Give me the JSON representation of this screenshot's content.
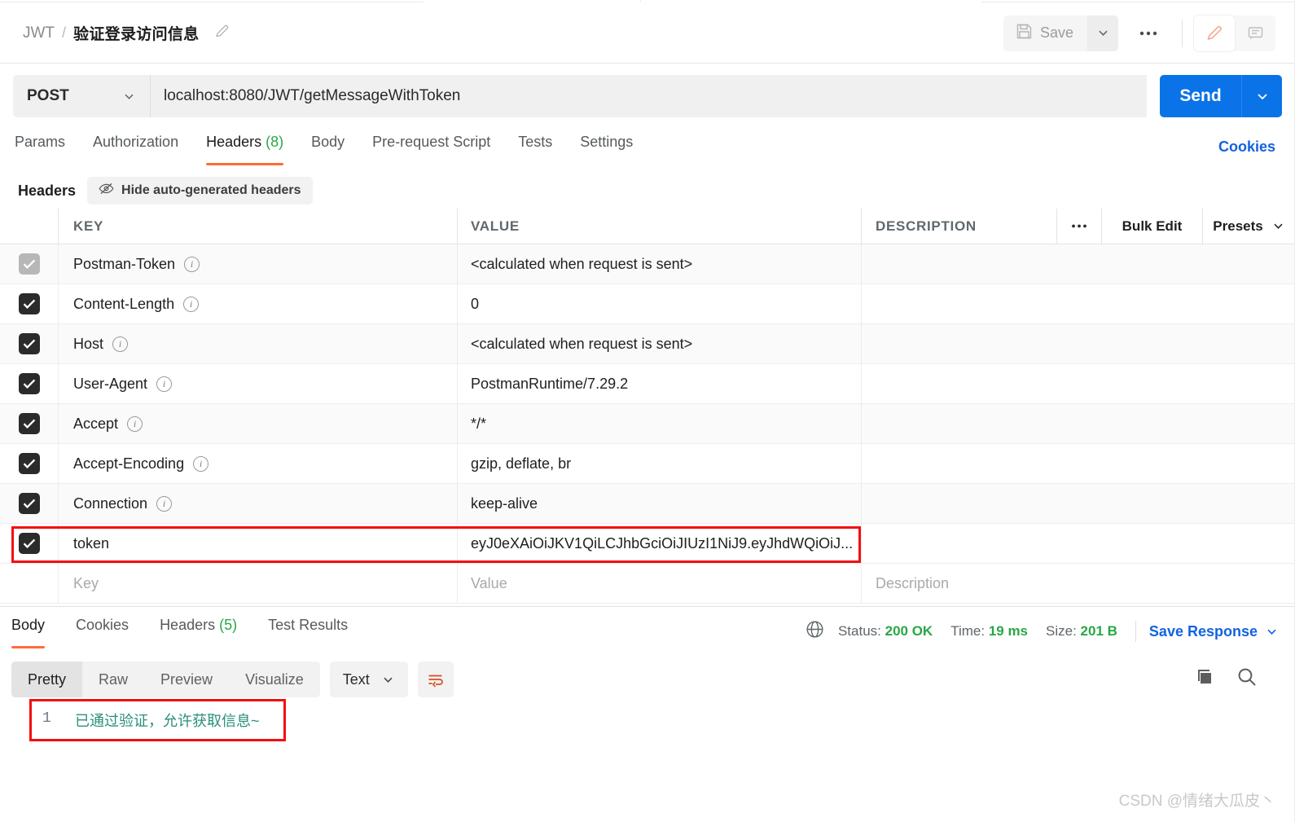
{
  "header": {
    "breadcrumb_root": "JWT",
    "breadcrumb_sep": "/",
    "breadcrumb_name": "验证登录访问信息",
    "save_label": "Save"
  },
  "url_bar": {
    "method": "POST",
    "url": "localhost:8080/JWT/getMessageWithToken",
    "send_label": "Send"
  },
  "request_tabs": [
    {
      "label": "Params",
      "count": "",
      "active": false
    },
    {
      "label": "Authorization",
      "count": "",
      "active": false
    },
    {
      "label": "Headers",
      "count": "(8)",
      "active": true
    },
    {
      "label": "Body",
      "count": "",
      "active": false
    },
    {
      "label": "Pre-request Script",
      "count": "",
      "active": false
    },
    {
      "label": "Tests",
      "count": "",
      "active": false
    },
    {
      "label": "Settings",
      "count": "",
      "active": false
    }
  ],
  "cookies_link": "Cookies",
  "headers_subbar": {
    "title": "Headers",
    "hide_auto_label": "Hide auto-generated headers"
  },
  "headers_table": {
    "columns": {
      "key": "KEY",
      "value": "VALUE",
      "description": "DESCRIPTION",
      "bulk_edit": "Bulk Edit",
      "presets": "Presets"
    },
    "rows": [
      {
        "checked": true,
        "disabled": true,
        "key": "Postman-Token",
        "has_info": true,
        "value": "<calculated when request is sent>",
        "description": "",
        "highlighted": false
      },
      {
        "checked": true,
        "disabled": false,
        "key": "Content-Length",
        "has_info": true,
        "value": "0",
        "description": "",
        "highlighted": false
      },
      {
        "checked": true,
        "disabled": false,
        "key": "Host",
        "has_info": true,
        "value": "<calculated when request is sent>",
        "description": "",
        "highlighted": false
      },
      {
        "checked": true,
        "disabled": false,
        "key": "User-Agent",
        "has_info": true,
        "value": "PostmanRuntime/7.29.2",
        "description": "",
        "highlighted": false
      },
      {
        "checked": true,
        "disabled": false,
        "key": "Accept",
        "has_info": true,
        "value": "*/*",
        "description": "",
        "highlighted": false
      },
      {
        "checked": true,
        "disabled": false,
        "key": "Accept-Encoding",
        "has_info": true,
        "value": "gzip, deflate, br",
        "description": "",
        "highlighted": false
      },
      {
        "checked": true,
        "disabled": false,
        "key": "Connection",
        "has_info": true,
        "value": "keep-alive",
        "description": "",
        "highlighted": false
      },
      {
        "checked": true,
        "disabled": false,
        "key": "token",
        "has_info": false,
        "value": "eyJ0eXAiOiJKV1QiLCJhbGciOiJIUzI1NiJ9.eyJhdWQiOiJ...",
        "description": "",
        "highlighted": true
      }
    ],
    "empty_row": {
      "key_placeholder": "Key",
      "value_placeholder": "Value",
      "description_placeholder": "Description"
    }
  },
  "response": {
    "tabs": [
      {
        "label": "Body",
        "count": "",
        "active": true
      },
      {
        "label": "Cookies",
        "count": "",
        "active": false
      },
      {
        "label": "Headers",
        "count": "(5)",
        "active": false
      },
      {
        "label": "Test Results",
        "count": "",
        "active": false
      }
    ],
    "status_label": "Status:",
    "status_value": "200 OK",
    "time_label": "Time:",
    "time_value": "19 ms",
    "size_label": "Size:",
    "size_value": "201 B",
    "save_response": "Save Response",
    "view_modes": [
      {
        "label": "Pretty",
        "active": true
      },
      {
        "label": "Raw",
        "active": false
      },
      {
        "label": "Preview",
        "active": false
      },
      {
        "label": "Visualize",
        "active": false
      }
    ],
    "format": "Text",
    "line_number": "1",
    "body_text": "已通过验证，允许获取信息~"
  },
  "watermark": "CSDN @情绪大瓜皮丶",
  "colors": {
    "accent_orange": "#ff6c37",
    "link_blue": "#1263e0",
    "send_blue": "#0b73e8",
    "success_green": "#28a745",
    "body_teal": "#2a8f7a",
    "highlight_red": "#f50d0d"
  }
}
